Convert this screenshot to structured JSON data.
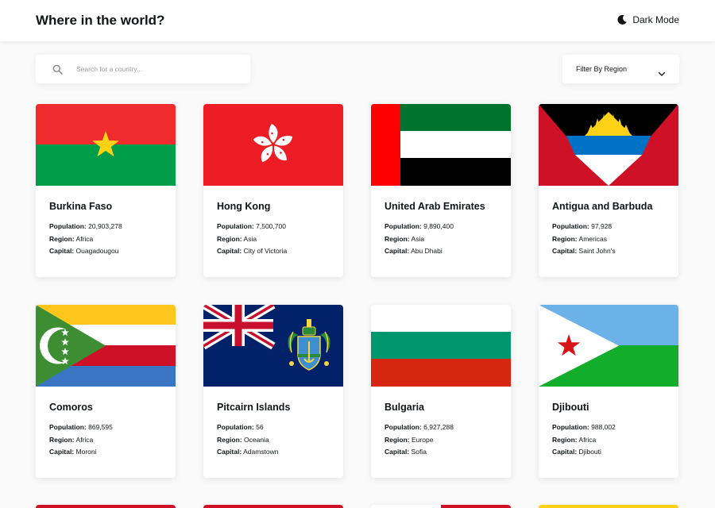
{
  "header": {
    "title": "Where in the world?",
    "dark_mode_label": "Dark Mode"
  },
  "search": {
    "placeholder": "Search for a country..."
  },
  "filter": {
    "label": "Filter By Region"
  },
  "field_labels": {
    "population": "Population:",
    "region": "Region:",
    "capital": "Capital:"
  },
  "countries": [
    {
      "name": "Burkina Faso",
      "population": "20,903,278",
      "region": "Africa",
      "capital": "Ouagadougou",
      "flag_icon": "burkina-faso-flag-icon",
      "flag_colors": [
        "#ef2b2d",
        "#009e49",
        "#fcd116"
      ]
    },
    {
      "name": "Hong Kong",
      "population": "7,500,700",
      "region": "Asia",
      "capital": "City of Victoria",
      "flag_icon": "hong-kong-flag-icon",
      "flag_colors": [
        "#de2910",
        "#ffffff"
      ]
    },
    {
      "name": "United Arab Emirates",
      "population": "9,890,400",
      "region": "Asia",
      "capital": "Abu Dhabi",
      "flag_icon": "uae-flag-icon",
      "flag_colors": [
        "#ff0000",
        "#00732f",
        "#ffffff",
        "#000000"
      ]
    },
    {
      "name": "Antigua and Barbuda",
      "population": "97,928",
      "region": "Americas",
      "capital": "Saint John's",
      "flag_icon": "antigua-barbuda-flag-icon",
      "flag_colors": [
        "#ce1126",
        "#000000",
        "#0072c6",
        "#fcd116",
        "#ffffff"
      ]
    },
    {
      "name": "Comoros",
      "population": "869,595",
      "region": "Africa",
      "capital": "Moroni",
      "flag_icon": "comoros-flag-icon",
      "flag_colors": [
        "#ffc61e",
        "#ffffff",
        "#ce1126",
        "#3a75c4",
        "#3d8e33"
      ]
    },
    {
      "name": "Pitcairn Islands",
      "population": "56",
      "region": "Oceania",
      "capital": "Adamstown",
      "flag_icon": "pitcairn-flag-icon",
      "flag_colors": [
        "#012169",
        "#ffffff",
        "#c8102e"
      ]
    },
    {
      "name": "Bulgaria",
      "population": "6,927,288",
      "region": "Europe",
      "capital": "Sofia",
      "flag_icon": "bulgaria-flag-icon",
      "flag_colors": [
        "#ffffff",
        "#00966e",
        "#d62612"
      ]
    },
    {
      "name": "Djibouti",
      "population": "988,002",
      "region": "Africa",
      "capital": "Djibouti",
      "flag_icon": "djibouti-flag-icon",
      "flag_colors": [
        "#6ab2e7",
        "#12ad2b",
        "#ffffff",
        "#d7141a"
      ]
    }
  ],
  "colors": {
    "background": "#fafafa",
    "surface": "#ffffff",
    "text": "#111517",
    "placeholder": "#9a9ca1"
  }
}
